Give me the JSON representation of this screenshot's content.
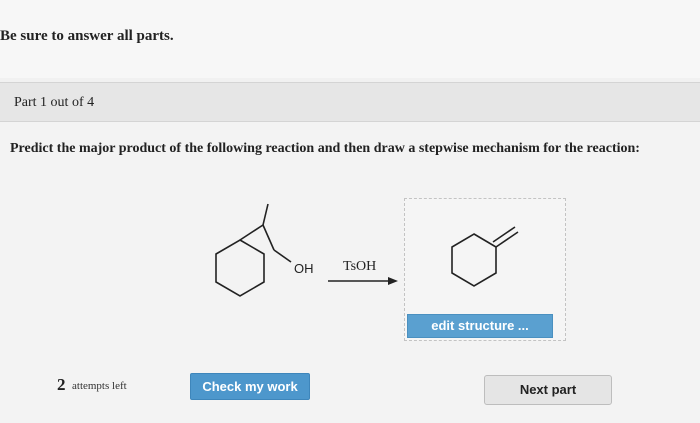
{
  "header": {
    "instructions": "Be sure to answer all parts."
  },
  "part": {
    "label": "Part 1 out of 4"
  },
  "question": {
    "text": "Predict the major product of the following reaction and then draw a stepwise mechanism for the reaction:"
  },
  "scheme": {
    "reactant_group_label": "OH",
    "reagent_label": "TsOH"
  },
  "answer": {
    "edit_structure_label": "edit structure ..."
  },
  "footer": {
    "attempts_count": "2",
    "attempts_label": "attempts left",
    "check_work_label": "Check my work",
    "next_part_label": "Next part"
  },
  "colors": {
    "accent_blue": "#4d97cc",
    "edit_blue": "#5aa0d0",
    "background": "#f1f1f1"
  }
}
